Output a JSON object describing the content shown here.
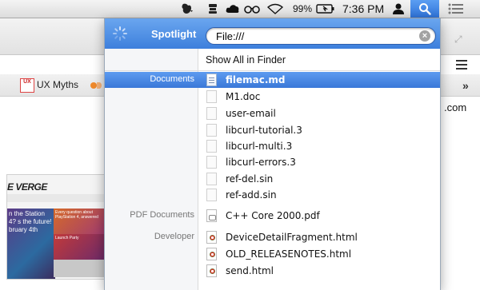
{
  "menubar": {
    "battery_percent": "99%",
    "clock": "7:36 PM",
    "icons": [
      "evernote-icon",
      "timemachine-icon",
      "cloud-icon",
      "glasses-icon",
      "wifi-icon",
      "battery-icon",
      "user-icon",
      "spotlight-icon",
      "notification-center-icon"
    ]
  },
  "browser": {
    "bookmark_label": "UX Myths",
    "bookmark_logo_text": "UX",
    "partial_email": ".com",
    "chevrons": "»",
    "thumbnail": {
      "header": "E VERGE",
      "hero_text": "n the Station 4? s the future! bruary 4th",
      "card1_text": "Every question about PlayStation 4, answered",
      "card2_text": "Launch Party"
    }
  },
  "spotlight": {
    "title": "Spotlight",
    "query": "File:///",
    "clear_symbol": "×",
    "show_all": "Show All in Finder",
    "results": [
      {
        "category": "Documents",
        "label": "filemac.md",
        "icon": "markdown-doc-icon",
        "kind": "doc",
        "selected": true
      },
      {
        "category": "",
        "label": "M1.doc",
        "icon": "file-icon",
        "kind": "blank",
        "selected": false
      },
      {
        "category": "",
        "label": "user-email",
        "icon": "file-icon",
        "kind": "blank",
        "selected": false
      },
      {
        "category": "",
        "label": "libcurl-tutorial.3",
        "icon": "file-icon",
        "kind": "blank",
        "selected": false
      },
      {
        "category": "",
        "label": "libcurl-multi.3",
        "icon": "file-icon",
        "kind": "blank",
        "selected": false
      },
      {
        "category": "",
        "label": "libcurl-errors.3",
        "icon": "file-icon",
        "kind": "blank",
        "selected": false
      },
      {
        "category": "",
        "label": "ref-del.sin",
        "icon": "file-icon",
        "kind": "blank",
        "selected": false
      },
      {
        "category": "",
        "label": "ref-add.sin",
        "icon": "file-icon",
        "kind": "blank",
        "selected": false
      },
      {
        "category": "PDF Documents",
        "label": "C++ Core 2000.pdf",
        "icon": "pdf-icon",
        "kind": "pdf",
        "selected": false
      },
      {
        "category": "Developer",
        "label": "DeviceDetailFragment.html",
        "icon": "html-icon",
        "kind": "html",
        "selected": false
      },
      {
        "category": "",
        "label": "OLD_RELEASENOTES.html",
        "icon": "html-icon",
        "kind": "html",
        "selected": false
      },
      {
        "category": "",
        "label": "send.html",
        "icon": "html-icon",
        "kind": "html",
        "selected": false
      }
    ]
  }
}
